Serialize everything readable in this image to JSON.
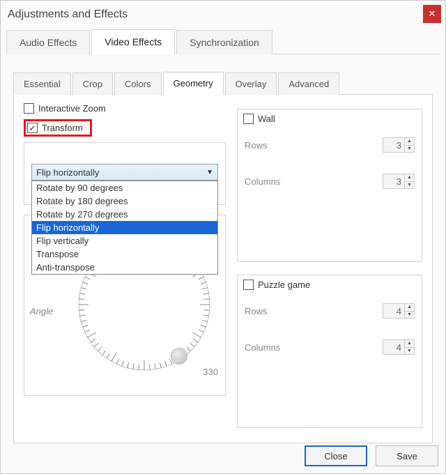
{
  "window_title": "Adjustments and Effects",
  "main_tabs": {
    "audio": "Audio Effects",
    "video": "Video Effects",
    "sync": "Synchronization"
  },
  "sub_tabs": {
    "essential": "Essential",
    "crop": "Crop",
    "colors": "Colors",
    "geometry": "Geometry",
    "overlay": "Overlay",
    "advanced": "Advanced"
  },
  "left": {
    "interactive_zoom": "Interactive Zoom",
    "transform": "Transform",
    "combo_value": "Flip horizontally",
    "options": [
      "Rotate by 90 degrees",
      "Rotate by 180 degrees",
      "Rotate by 270 degrees",
      "Flip horizontally",
      "Flip vertically",
      "Transpose",
      "Anti-transpose"
    ],
    "angle_label": "Angle",
    "angle_value": "330"
  },
  "wall": {
    "title": "Wall",
    "rows_label": "Rows",
    "rows_value": "3",
    "cols_label": "Columns",
    "cols_value": "3"
  },
  "puzzle": {
    "title": "Puzzle game",
    "rows_label": "Rows",
    "rows_value": "4",
    "cols_label": "Columns",
    "cols_value": "4"
  },
  "buttons": {
    "close": "Close",
    "save": "Save"
  }
}
